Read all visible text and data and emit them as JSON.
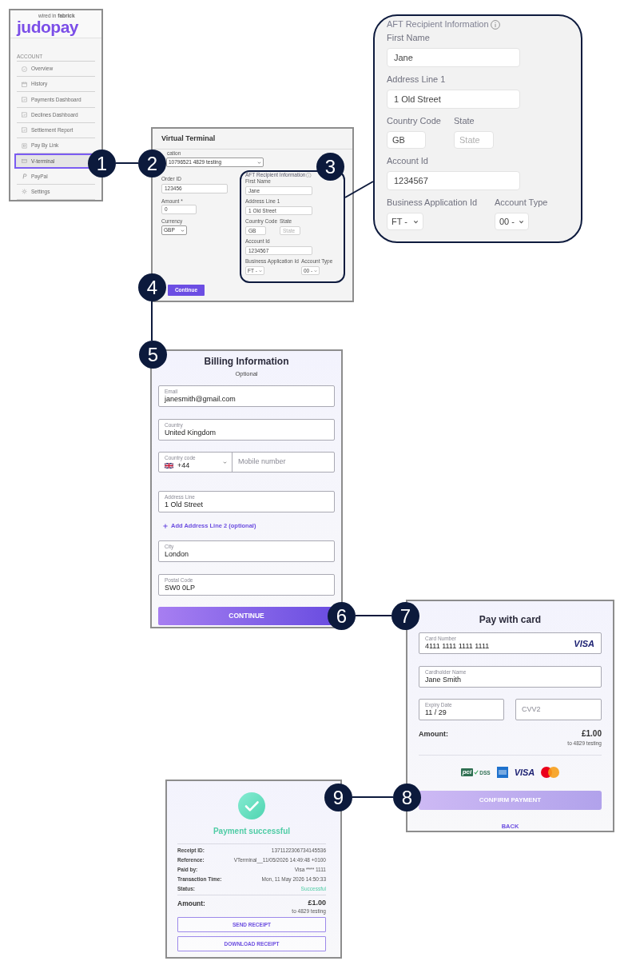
{
  "sidebar": {
    "tagline": "wired in **fabrick**",
    "logo": "judopay",
    "section": "ACCOUNT",
    "items": [
      {
        "label": "Overview",
        "selected": false
      },
      {
        "label": "History",
        "selected": false
      },
      {
        "label": "Payments Dashboard",
        "selected": false
      },
      {
        "label": "Declines Dashboard",
        "selected": false
      },
      {
        "label": "Settlement Report",
        "selected": false
      },
      {
        "label": "Pay By Link",
        "selected": false
      },
      {
        "label": "V-terminal",
        "selected": true
      },
      {
        "label": "PayPal",
        "selected": false
      },
      {
        "label": "Settings",
        "selected": false
      }
    ]
  },
  "virtual_terminal": {
    "title": "Virtual Terminal",
    "location": {
      "label": "cation",
      "value": "10796521 4829 testing"
    },
    "order_id": {
      "label": "Order ID",
      "value": "123456"
    },
    "amount": {
      "label": "Amount *",
      "value": "0"
    },
    "currency": {
      "label": "Currency",
      "value": "GBP"
    },
    "recipient": {
      "title": "AFT Recipient Information",
      "first_name": {
        "label": "First Name",
        "value": "Jane"
      },
      "address_line_1": {
        "label": "Address Line 1",
        "value": "1 Old Street"
      },
      "country_code": {
        "label": "Country Code",
        "value": "GB"
      },
      "state": {
        "label": "State",
        "placeholder": "State"
      },
      "account_id": {
        "label": "Account Id",
        "value": "1234567"
      },
      "business_application_id": {
        "label": "Business Application Id",
        "value": "FT -"
      },
      "account_type": {
        "label": "Account Type",
        "value": "00 -"
      }
    },
    "button": "Continue"
  },
  "recipient_zoom": {
    "title": "AFT Recipient Information",
    "first_name": {
      "label": "First Name",
      "value": "Jane"
    },
    "address_line_1": {
      "label": "Address Line 1",
      "value": "1 Old Street"
    },
    "country_code": {
      "label": "Country Code",
      "value": "GB"
    },
    "state": {
      "label": "State",
      "placeholder": "State"
    },
    "account_id": {
      "label": "Account Id",
      "value": "1234567"
    },
    "business_application_id": {
      "label": "Business Application Id",
      "value": "FT -"
    },
    "account_type": {
      "label": "Account Type",
      "value": "00 -"
    }
  },
  "billing": {
    "title": "Billing Information",
    "subtitle": "Optional",
    "fields": [
      {
        "kind": "text",
        "label": "Email",
        "value": "janesmith@gmail.com"
      },
      {
        "kind": "text",
        "label": "Country",
        "value": "United Kingdom"
      },
      {
        "kind": "phone",
        "label": "Country code",
        "value": "+44",
        "placeholder": "Mobile number"
      },
      {
        "kind": "text",
        "label": "Address Line",
        "value": "1 Old Street"
      },
      {
        "kind": "link",
        "label": "Add Address Line 2 (optional)"
      },
      {
        "kind": "text",
        "label": "City",
        "value": "London"
      },
      {
        "kind": "text",
        "label": "Postal Code",
        "value": "SW0 0LP"
      }
    ],
    "button": "CONTINUE"
  },
  "card_payment": {
    "title": "Pay with card",
    "card_number": {
      "label": "Card Number",
      "value": "4111 1111 1111 1111",
      "brand": "VISA"
    },
    "cardholder": {
      "label": "Cardholder Name",
      "value": "Jane Smith"
    },
    "expiry": {
      "label": "Expiry Date",
      "value": "11 / 29"
    },
    "cvv": {
      "placeholder": "CVV2"
    },
    "amount_label": "Amount:",
    "amount": "£1.00",
    "payee": "to 4829 testing",
    "logos": {
      "pci": "pci",
      "dss": "DSS",
      "visa": "VISA"
    },
    "button": "CONFIRM PAYMENT",
    "back": "BACK"
  },
  "payment_success": {
    "title": "Payment successful",
    "rows": [
      {
        "kind": "plain",
        "label": "Receipt ID:",
        "value": "1371122306734145536"
      },
      {
        "kind": "plain",
        "label": "Reference:",
        "value": "VTerminal__11/05/2026 14:49:48 +0100"
      },
      {
        "kind": "plain",
        "label": "Paid by:",
        "value": "Visa **** 1111"
      },
      {
        "kind": "plain",
        "label": "Transaction Time:",
        "value": "Mon, 11 May 2026 14:50:33"
      },
      {
        "kind": "status",
        "label": "Status:",
        "value": "Successful"
      }
    ],
    "amount_label": "Amount:",
    "amount": "£1.00",
    "payee": "to 4829 testing",
    "buttons": [
      "SEND RECEIPT",
      "DOWNLOAD RECEIPT"
    ]
  },
  "callouts": [
    "1",
    "2",
    "3",
    "4",
    "5",
    "6",
    "7",
    "8",
    "9"
  ]
}
